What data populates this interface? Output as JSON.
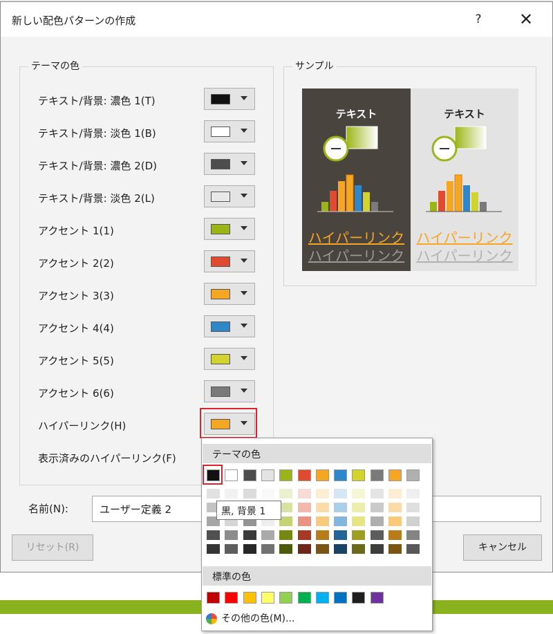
{
  "dialog": {
    "title": "新しい配色パターンの作成",
    "help_glyph": "?",
    "close_glyph": "✕"
  },
  "theme_group": {
    "title": "テーマの色",
    "rows": [
      {
        "label": "テキスト/背景: 濃色 1(T)",
        "color": "#111111"
      },
      {
        "label": "テキスト/背景: 淡色 1(B)",
        "color": "#ffffff"
      },
      {
        "label": "テキスト/背景: 濃色 2(D)",
        "color": "#4d4d4d"
      },
      {
        "label": "テキスト/背景: 淡色 2(L)",
        "color": "#e9e9e9"
      },
      {
        "label": "アクセント 1(1)",
        "color": "#9cb516"
      },
      {
        "label": "アクセント 2(2)",
        "color": "#e04a2f"
      },
      {
        "label": "アクセント 3(3)",
        "color": "#f5a623"
      },
      {
        "label": "アクセント 4(4)",
        "color": "#2f86c8"
      },
      {
        "label": "アクセント 5(5)",
        "color": "#d3d32f"
      },
      {
        "label": "アクセント 6(6)",
        "color": "#7a7a7a"
      },
      {
        "label": "ハイパーリンク(H)",
        "color": "#f5a623"
      },
      {
        "label": "表示済みのハイパーリンク(F)",
        "color": ""
      }
    ]
  },
  "sample_group": {
    "title": "サンプル",
    "text": "テキスト",
    "link": "ハイパーリンク",
    "visited_link": "ハイパーリンク"
  },
  "name_field": {
    "label": "名前(N):",
    "value": "ユーザー定義 2"
  },
  "buttons": {
    "reset": "リセット(R)",
    "cancel": "キャンセル"
  },
  "color_popup": {
    "theme_header": "テーマの色",
    "theme_colors": [
      "#111111",
      "#ffffff",
      "#4d4d4d",
      "#e3e3e3",
      "#9cb516",
      "#e04a2f",
      "#f5a623",
      "#2f86c8",
      "#d3d32f",
      "#7a7a7a",
      "#f5a623",
      "#b0b0b0"
    ],
    "standard_header": "標準の色",
    "standard_colors": [
      "#c00000",
      "#ff0000",
      "#ffc000",
      "#ffff66",
      "#92d050",
      "#00b050",
      "#00b0f0",
      "#0070c0",
      "#1f1f1f",
      "#7030a0"
    ],
    "tooltip": "黒, 背景 1",
    "more_colors": "その他の色(M)..."
  }
}
